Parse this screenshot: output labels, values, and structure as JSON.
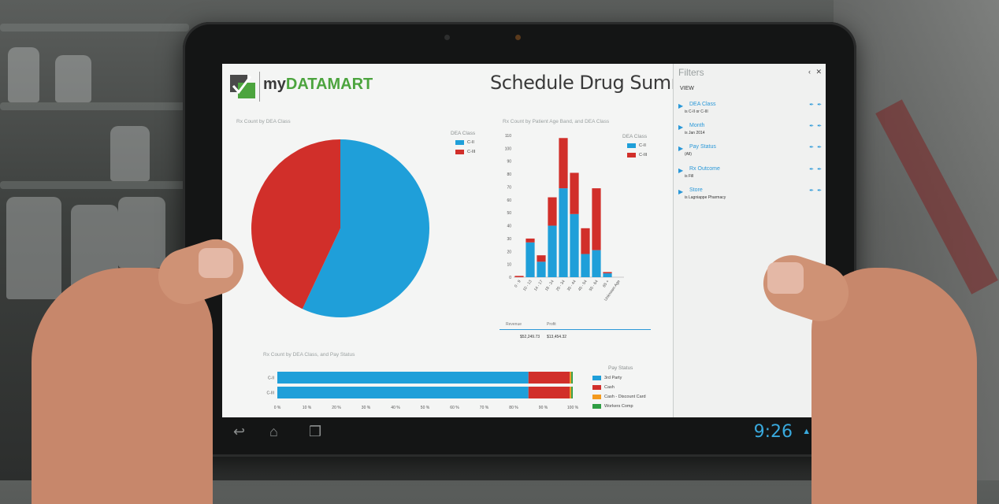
{
  "app": {
    "logo_my": "my",
    "logo_datamart": "DATAMART",
    "title": "Schedule Drug Summary"
  },
  "pie_chart": {
    "title": "Rx Count by DEA Class",
    "legend_title": "DEA Class",
    "legend": [
      "C-II",
      "C-III"
    ]
  },
  "age_chart": {
    "title": "Rx Count by Patient Age Band, and DEA Class",
    "legend_title": "DEA Class",
    "legend": [
      "C-II",
      "C-III"
    ],
    "kpis": [
      {
        "label": "Revenue",
        "value": "$52,249.73"
      },
      {
        "label": "Profit",
        "value": "$13,454.32"
      }
    ]
  },
  "pay_chart": {
    "title": "Rx Count by DEA Class, and Pay Status",
    "legend_title": "Pay Status",
    "legend": [
      "3rd Party",
      "Cash",
      "Cash - Discount Card",
      "Workers Comp"
    ]
  },
  "filters": {
    "title": "Filters",
    "view_label": "VIEW",
    "back_icon": "chevron-left-icon",
    "close_icon": "close-icon",
    "items": [
      {
        "label": "DEA Class",
        "value": "is C-II or C-III"
      },
      {
        "label": "Month",
        "value": "is Jan 2014"
      },
      {
        "label": "Pay Status",
        "value": "(All)"
      },
      {
        "label": "Rx Outcome",
        "value": "is Fill"
      },
      {
        "label": "Store",
        "value": "is Lagniappe Pharmacy"
      }
    ]
  },
  "statusbar": {
    "time": "9:26",
    "icons": [
      "back-icon",
      "home-icon",
      "recent-apps-icon"
    ]
  },
  "colors": {
    "blue": "#1f9fd9",
    "red": "#d12f2a",
    "orange": "#f39a1e",
    "green": "#2f9e44",
    "accent": "#39a9dd"
  },
  "chart_data": [
    {
      "type": "pie",
      "title": "Rx Count by DEA Class",
      "labels": [
        "C-II",
        "C-III"
      ],
      "values": [
        57,
        43
      ]
    },
    {
      "type": "bar",
      "stacked": true,
      "title": "Rx Count by Patient Age Band, and DEA Class",
      "categories": [
        "0 - 9",
        "10 - 13",
        "14 - 17",
        "18 - 24",
        "25 - 34",
        "35 - 44",
        "45 - 54",
        "55 - 64",
        "65 +",
        "Unknown Age"
      ],
      "series": [
        {
          "name": "C-II",
          "values": [
            0,
            27,
            12,
            40,
            69,
            49,
            18,
            21,
            3,
            0
          ]
        },
        {
          "name": "C-III",
          "values": [
            1,
            3,
            5,
            22,
            39,
            32,
            20,
            48,
            1,
            0
          ]
        }
      ],
      "ylim": [
        0,
        110
      ],
      "yticks": [
        0,
        10,
        20,
        30,
        40,
        50,
        60,
        70,
        80,
        90,
        100,
        110
      ]
    },
    {
      "type": "bar",
      "orientation": "horizontal",
      "stacked": true,
      "title": "Rx Count by DEA Class, and Pay Status",
      "categories": [
        "C-II",
        "C-III"
      ],
      "series": [
        {
          "name": "3rd Party",
          "values": [
            85,
            85
          ]
        },
        {
          "name": "Cash",
          "values": [
            14,
            14
          ]
        },
        {
          "name": "Cash - Discount Card",
          "values": [
            0.5,
            0.5
          ]
        },
        {
          "name": "Workers Comp",
          "values": [
            0.5,
            0.5
          ]
        }
      ],
      "xticks": [
        "0 %",
        "10 %",
        "20 %",
        "30 %",
        "40 %",
        "50 %",
        "60 %",
        "70 %",
        "80 %",
        "90 %",
        "100 %"
      ],
      "xlim": [
        0,
        100
      ]
    }
  ]
}
